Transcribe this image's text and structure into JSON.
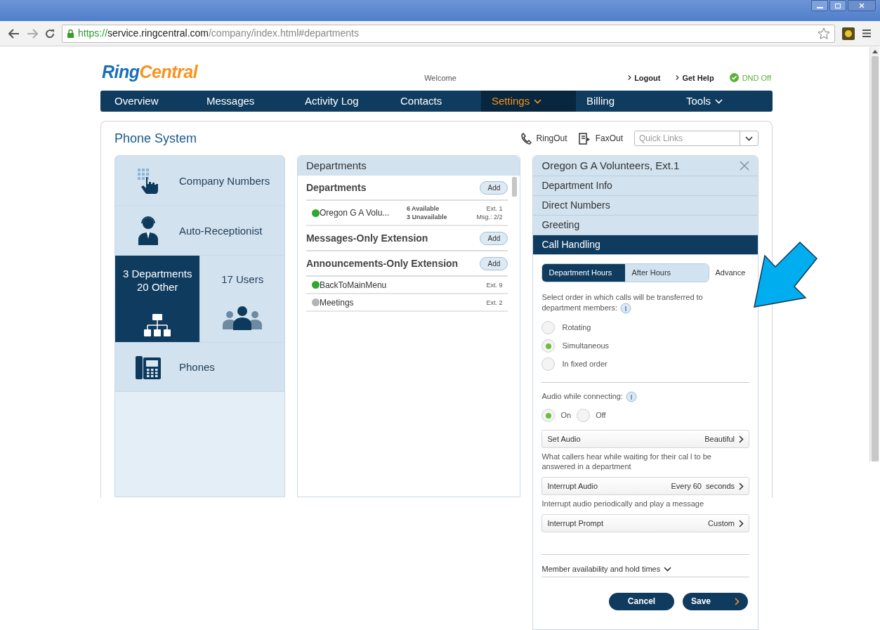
{
  "browser": {
    "scheme": "https://",
    "host": "service.ringcentral.com",
    "path": "/company/index.html#departments"
  },
  "header": {
    "logo": "RingCentral",
    "welcome": "Welcome",
    "links": [
      "Logout",
      "Get Help"
    ],
    "dnd": "DND Off"
  },
  "nav": [
    {
      "label": "Overview",
      "selected": false,
      "menu": false
    },
    {
      "label": "Messages",
      "selected": false,
      "menu": false
    },
    {
      "label": "Activity Log",
      "selected": false,
      "menu": false
    },
    {
      "label": "Contacts",
      "selected": false,
      "menu": false
    },
    {
      "label": "Settings",
      "selected": true,
      "menu": true
    },
    {
      "label": "Billing",
      "selected": false,
      "menu": false
    },
    {
      "label": "Tools",
      "selected": false,
      "menu": true
    }
  ],
  "page": {
    "title": "Phone System",
    "actions": [
      "RingOut",
      "FaxOut"
    ],
    "quick_links": {
      "placeholder": "Quick Links"
    }
  },
  "sidebar": [
    {
      "lines": [
        "Company Numbers"
      ],
      "selected": false
    },
    {
      "lines": [
        "Auto-Receptionist"
      ],
      "selected": false
    },
    {
      "lines": [
        "3 Departments",
        "20 Other"
      ],
      "selected": true
    },
    {
      "lines": [
        "17 Users"
      ],
      "selected": false
    },
    {
      "lines": [
        "Phones"
      ],
      "selected": false
    }
  ],
  "departments": {
    "title": "Departments",
    "sections": [
      {
        "title": "Departments",
        "add": "Add",
        "items": [
          {
            "name": "Oregon G A Volu...",
            "color": "#2fa82f",
            "status": [
              "6 Available",
              "3 Unavailable"
            ],
            "ext": [
              "Ext. 1",
              "Msg.: 2/2"
            ]
          }
        ]
      },
      {
        "title": "Messages-Only Extension",
        "add": "Add"
      },
      {
        "title": "Announcements-Only Extension",
        "add": "Add",
        "items": [
          {
            "name": "BackToMainMenu",
            "color": "#2fa82f",
            "ext": [
              "Ext. 9"
            ]
          },
          {
            "name": "Meetings",
            "color": "#b4b4b4",
            "ext": [
              "Ext. 2"
            ]
          }
        ]
      }
    ]
  },
  "detail": {
    "title": "Oregon G A Volunteers, Ext.1",
    "menu": [
      {
        "label": "Department Info",
        "selected": false
      },
      {
        "label": "Direct Numbers",
        "selected": false
      },
      {
        "label": "Greeting",
        "selected": false
      },
      {
        "label": "Call Handling",
        "selected": true
      }
    ],
    "tabs": [
      {
        "label": "Department Hours",
        "selected": true,
        "kind": "segment"
      },
      {
        "label": "After Hours",
        "selected": false,
        "kind": "segment"
      },
      {
        "label": "Advance",
        "selected": false,
        "kind": "link"
      }
    ],
    "order_prompt": "Select order in which calls will be transferred to department members:",
    "order_options": [
      {
        "label": "Rotating",
        "selected": false
      },
      {
        "label": "Simultaneous",
        "selected": true
      },
      {
        "label": "In fixed order",
        "selected": false
      }
    ],
    "audio_prompt": "Audio while connecting:",
    "audio_options": [
      {
        "label": "On",
        "selected": true
      },
      {
        "label": "Off",
        "selected": false
      }
    ],
    "settings": [
      {
        "kind": "row",
        "label": "Set Audio",
        "value": "Beautiful"
      },
      {
        "kind": "note",
        "label": "What callers hear while waiting for their cal l to be answered in a department"
      },
      {
        "kind": "row",
        "label": "Interrupt Audio",
        "value": "Every 60  seconds"
      },
      {
        "kind": "note",
        "label": "Interrupt audio periodically and play a message"
      },
      {
        "kind": "row",
        "label": "Interrupt Prompt",
        "value": "Custom"
      }
    ],
    "more": {
      "label": "Member availability and hold times",
      "expanded": false
    },
    "buttons": [
      "Cancel",
      "Save"
    ]
  }
}
